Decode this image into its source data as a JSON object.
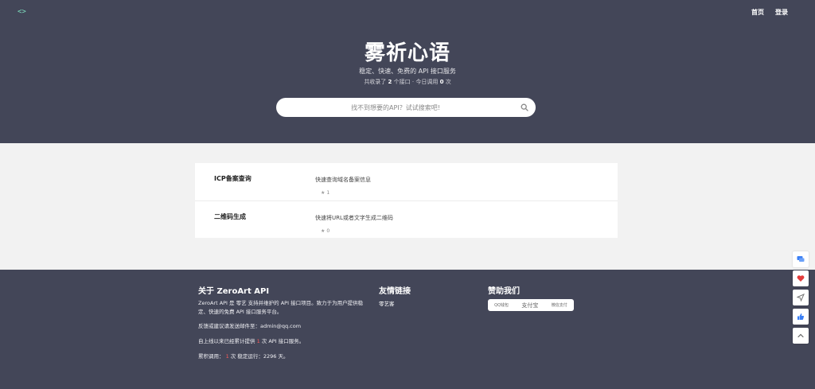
{
  "header": {
    "logo": "<>",
    "nav": [
      {
        "label": "首页"
      },
      {
        "label": "登录"
      }
    ]
  },
  "hero": {
    "title": "雾祈心语",
    "subtitle": "稳定、快速、免费的 API 接口服务",
    "stats_prefix": "共收录了",
    "api_count": "2",
    "stats_mid": "个接口 · 今日调用",
    "call_count": "0",
    "stats_suffix": "次"
  },
  "search": {
    "placeholder": "找不到想要的API？试试搜索吧!"
  },
  "apis": [
    {
      "name": "ICP备案查询",
      "desc": "快速查询域名备案信息",
      "stars": "1"
    },
    {
      "name": "二维码生成",
      "desc": "快速将URL或者文字生成二维码",
      "stars": "0"
    }
  ],
  "footer": {
    "about_title": "关于 ZeroArt API",
    "about_text": "ZeroArt API 是 零艺 支持并维护的 API 接口项目。致力于为用户提供稳定、快速的免费 API 接口服务平台。",
    "feedback": "反馈或建议请发送邮件至：admin@qq.com",
    "served_prefix": "自上线以来已经累计提供",
    "served_count": "1",
    "served_suffix": "次 API 接口服务。",
    "total_prefix": "累积调用：",
    "total_count": "1",
    "total_mid": "次  稳定运行：2296 天。",
    "links_title": "友情链接",
    "links": [
      {
        "label": "零艺客"
      }
    ],
    "sponsor_title": "赞助我们",
    "sponsors": [
      "QQ钱包",
      "支付宝",
      "微信支付"
    ]
  },
  "colors": {
    "hero_bg": "#434658",
    "page_bg": "#f2f2f2",
    "accent_red": "#ff5a5a",
    "tool_blue": "#3b7ff5",
    "tool_red": "#e23b3b"
  },
  "side_tools": [
    {
      "icon": "chat-icon"
    },
    {
      "icon": "heart-icon"
    },
    {
      "icon": "send-icon"
    },
    {
      "icon": "thumbs-up-icon"
    },
    {
      "icon": "chevron-up-icon"
    }
  ]
}
